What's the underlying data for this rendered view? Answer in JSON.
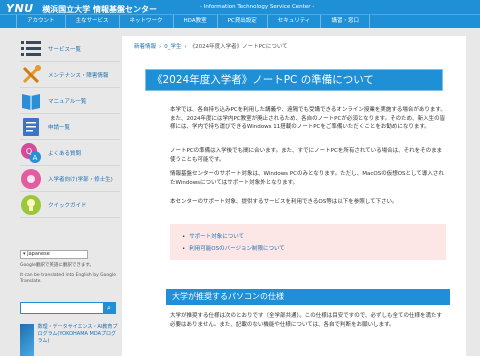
{
  "header": {
    "logo_main": "YNU",
    "logo_org": "横浜国立大学 情報基盤センター",
    "tagline": "- Information Technology Service Center -"
  },
  "nav": {
    "items": [
      "アカウント",
      "主なサービス",
      "ネットワーク",
      "HDA教室",
      "PC貸出設定",
      "セキュリティ",
      "講習・窓口"
    ]
  },
  "sidebar": {
    "items": [
      {
        "label": "サービス一覧",
        "icon": "list-icon",
        "color": "#3a4a5a"
      },
      {
        "label": "メンテナンス・障害情報",
        "icon": "wrench-screwdriver-icon",
        "color": "#e59a2a"
      },
      {
        "label": "マニュアル一覧",
        "icon": "book-icon",
        "color": "#2a8fd6"
      },
      {
        "label": "申請一覧",
        "icon": "document-icon",
        "color": "#3a76c4"
      },
      {
        "label": "よくある質問",
        "icon": "qa-icon",
        "color": "#d64a9a"
      },
      {
        "label": "入学者向け(学部・修士生)",
        "icon": "flower-icon",
        "color": "#e45ca0"
      },
      {
        "label": "クイックガイド",
        "icon": "lightbulb-icon",
        "color": "#9ac83a"
      }
    ],
    "language_select": "Japanese",
    "translate_note_1": "Google翻訳で英語に翻訳できます。",
    "translate_note_2": "It can be translated into English by Google Translate.",
    "banner_text": "数理・データサイエンス・AI教育プログラム(YOKOHAMA MDAプログラム)"
  },
  "main": {
    "breadcrumb": [
      "新着情報",
      "0_学生",
      "《2024年度入学者》ノートPCについて"
    ],
    "title": "《2024年度入学者》ノートPC の準備について",
    "p1": "本学では、各自持ち込みPCを利用した講義や、遠隔でも受講できるオンライン授業を実施する場合があります。また、2024年度には学内PC教室が廃止されるため、各自のノートPCが必須となります。そのため、新入生の皆様には、学内で持ち運びできるWindows 11搭載のノートPCをご準備いただくことをお勧めになります。",
    "p2": "ノートPCの準備は入学後でも間に合います。また、すでにノートPCを所有されている場合は、それをそのまま使うことも可能です。",
    "p3": "情報基盤センターのサポート対象は、Windows PCのみとなります。ただし、MacOSの仮想OSとして導入されたWindowsについてはサポート対象外となります。",
    "p4": "本センターのサポート対象、提供するサービスを利用できるOS等は以下を参照して下さい。",
    "notice_links": [
      "サポート対象について",
      "利用可能OSのバージョン制限について"
    ],
    "section_title": "大学が推奨するパソコンの仕様",
    "p5": "大学が推奨する仕様は次のとおりです（全学部共通）。この仕様は目安ですので、必ずしも全ての仕様を満たす必要はありません。また、記載のない機能や仕様については、各自で判断をお願いします。"
  },
  "colors": {
    "brand_blue": "#1f8fd6",
    "link_blue": "#1f6fb0",
    "notice_bg": "#fde6e6"
  }
}
